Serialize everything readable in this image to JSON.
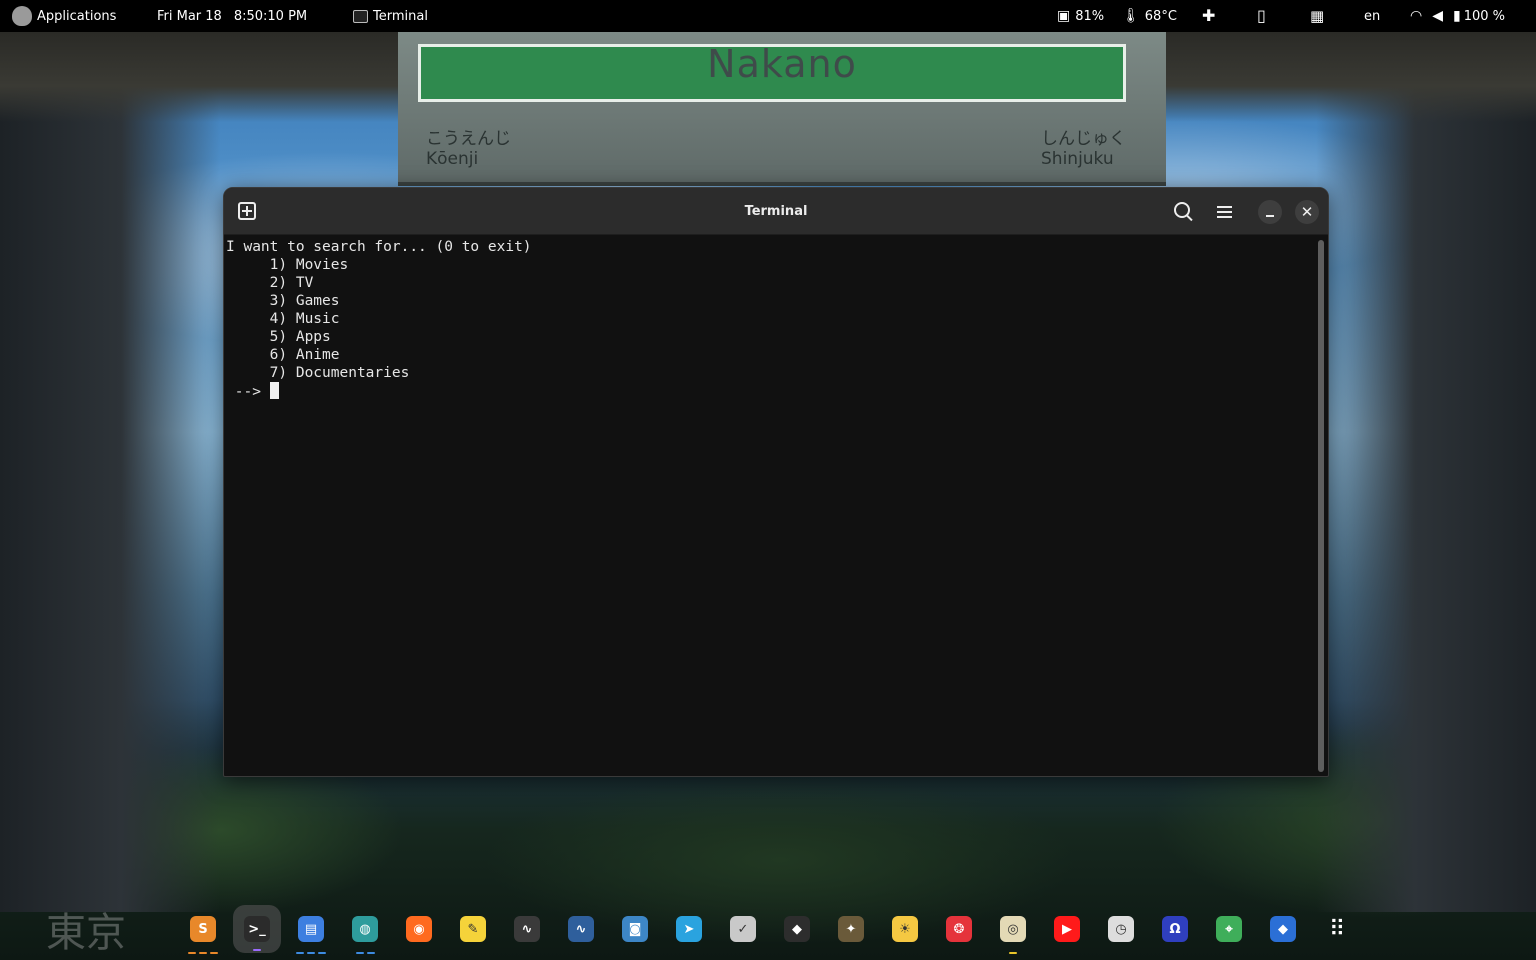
{
  "topbar": {
    "applications_label": "Applications",
    "date": "Fri Mar 18",
    "time": "8:50:10 PM",
    "active_window_label": "Terminal",
    "cpu_percent": "81%",
    "temperature": "68°C",
    "keyboard_layout": "en",
    "battery": "100 %"
  },
  "wallpaper": {
    "sign_station": "Nakano",
    "sign_left_kana": "こうえんじ",
    "sign_left_roman": "Kōenji",
    "sign_right_kana": "しんじゅく",
    "sign_right_roman": "Shinjuku",
    "corner_logo": "東京"
  },
  "window": {
    "title": "Terminal",
    "lines": [
      "I want to search for... (0 to exit)",
      "     1) Movies",
      "     2) TV",
      "     3) Games",
      "     4) Music",
      "     5) Apps",
      "     6) Anime",
      "     7) Documentaries"
    ],
    "prompt": " --> "
  },
  "dock": {
    "items": [
      {
        "name": "sublime-text",
        "glyph": "S",
        "color": "#e8882a",
        "indicator": "#e8882a",
        "dots": 3
      },
      {
        "name": "terminal",
        "glyph": ">_",
        "color": "#2b2b2b",
        "indicator": "#9b6bff",
        "dots": 1,
        "active": true
      },
      {
        "name": "files",
        "glyph": "▤",
        "color": "#3d7fe0",
        "indicator": "#3d8be0",
        "dots": 3
      },
      {
        "name": "web-browser",
        "glyph": "◍",
        "color": "#2e9c9c",
        "indicator": "#3d8be0",
        "dots": 2
      },
      {
        "name": "firefox",
        "glyph": "◉",
        "color": "#ff6a1f",
        "indicator": "",
        "dots": 0
      },
      {
        "name": "text-editor",
        "glyph": "✎",
        "color": "#f5d33a",
        "indicator": "",
        "dots": 0
      },
      {
        "name": "system-monitor",
        "glyph": "∿",
        "color": "#3a3a3a",
        "indicator": "",
        "dots": 0
      },
      {
        "name": "resources",
        "glyph": "∿",
        "color": "#2f5f9c",
        "indicator": "",
        "dots": 0
      },
      {
        "name": "screenshot",
        "glyph": "◙",
        "color": "#3d86c6",
        "indicator": "",
        "dots": 0
      },
      {
        "name": "telegram",
        "glyph": "➤",
        "color": "#2aa3df",
        "indicator": "",
        "dots": 0
      },
      {
        "name": "search-tool",
        "glyph": "✓",
        "color": "#c9c9c9",
        "indicator": "",
        "dots": 0
      },
      {
        "name": "inkscape",
        "glyph": "◆",
        "color": "#2d2d2d",
        "indicator": "",
        "dots": 0
      },
      {
        "name": "gimp",
        "glyph": "✦",
        "color": "#6a5a3a",
        "indicator": "",
        "dots": 0
      },
      {
        "name": "weather",
        "glyph": "☀",
        "color": "#f5c842",
        "indicator": "",
        "dots": 0
      },
      {
        "name": "lifesaver-app",
        "glyph": "❂",
        "color": "#e5333b",
        "indicator": "",
        "dots": 0
      },
      {
        "name": "music-player",
        "glyph": "◎",
        "color": "#e3d9b5",
        "indicator": "#e8c52a",
        "dots": 1
      },
      {
        "name": "youtube",
        "glyph": "▶",
        "color": "#ff1a1a",
        "indicator": "",
        "dots": 0
      },
      {
        "name": "clock-app",
        "glyph": "◷",
        "color": "#dddddd",
        "indicator": "",
        "dots": 0
      },
      {
        "name": "headset-app",
        "glyph": "Ω",
        "color": "#2f3fbf",
        "indicator": "",
        "dots": 0
      },
      {
        "name": "maps",
        "glyph": "⌖",
        "color": "#3fae5a",
        "indicator": "",
        "dots": 0
      },
      {
        "name": "git-app",
        "glyph": "◆",
        "color": "#2b6fd6",
        "indicator": "",
        "dots": 0
      },
      {
        "name": "show-apps",
        "glyph": "⠿",
        "color": "transparent",
        "indicator": "",
        "dots": 0
      }
    ]
  }
}
